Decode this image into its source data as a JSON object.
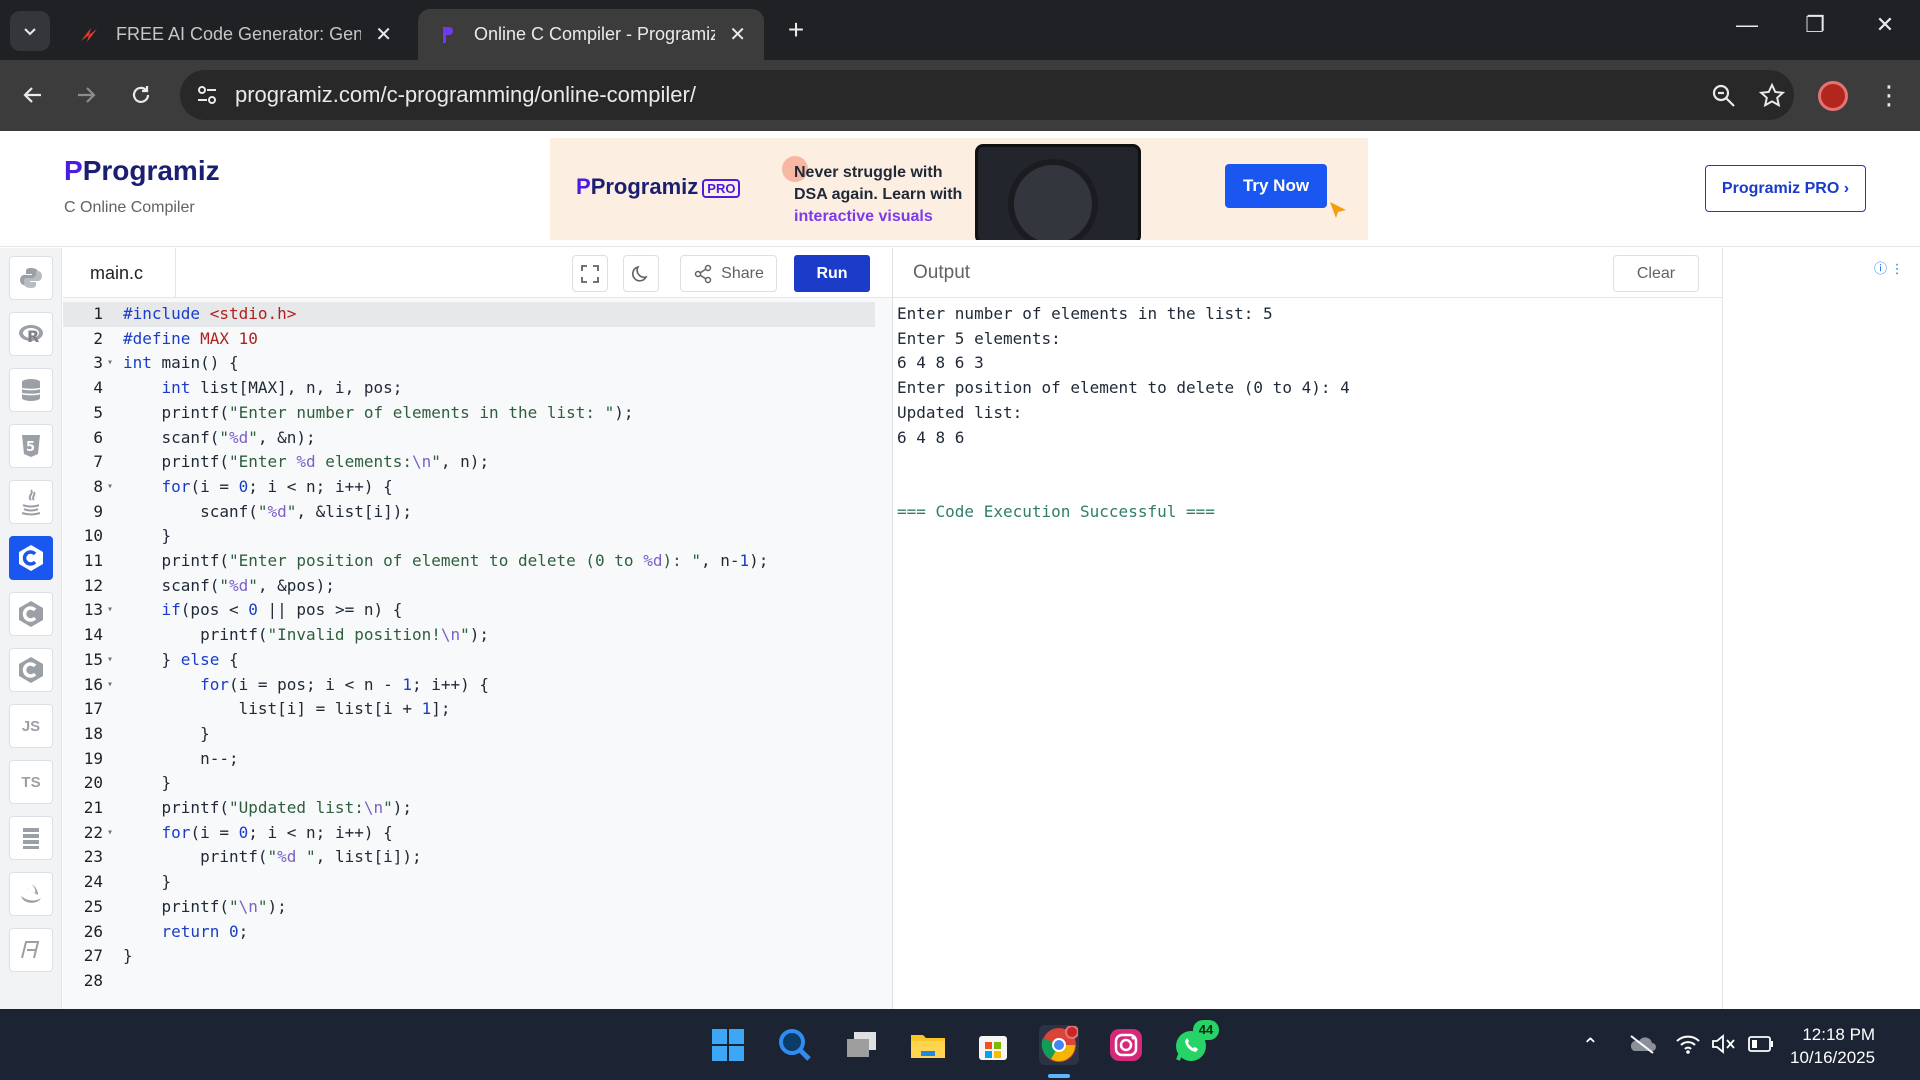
{
  "browser": {
    "tabs": [
      {
        "title": "FREE AI Code Generator: Gener",
        "active": false
      },
      {
        "title": "Online C Compiler - Programiz",
        "active": true
      }
    ],
    "url": "programiz.com/c-programming/online-compiler/"
  },
  "header": {
    "logo": "Programiz",
    "subtitle": "C Online Compiler",
    "ad": {
      "logo": "Programiz",
      "logo_badge": "PRO",
      "text_line1": "Never struggle with",
      "text_line2": "DSA again. Learn with",
      "text_line3": "interactive visuals",
      "cta": "Try Now"
    },
    "pro_button": "Programiz PRO ›"
  },
  "sidebar": {
    "languages": [
      {
        "name": "python",
        "label": ""
      },
      {
        "name": "r",
        "label": ""
      },
      {
        "name": "sql",
        "label": ""
      },
      {
        "name": "html",
        "label": ""
      },
      {
        "name": "java",
        "label": ""
      },
      {
        "name": "c",
        "label": "",
        "active": true
      },
      {
        "name": "cpp",
        "label": ""
      },
      {
        "name": "csharp",
        "label": ""
      },
      {
        "name": "js",
        "label": "JS"
      },
      {
        "name": "ts",
        "label": "TS"
      },
      {
        "name": "go",
        "label": ""
      },
      {
        "name": "swift",
        "label": ""
      },
      {
        "name": "php",
        "label": ""
      }
    ]
  },
  "editor": {
    "file_name": "main.c",
    "share_label": "Share",
    "run_label": "Run",
    "lines": [
      "#include <stdio.h>",
      "#define MAX 10",
      "int main() {",
      "    int list[MAX], n, i, pos;",
      "    printf(\"Enter number of elements in the list: \");",
      "    scanf(\"%d\", &n);",
      "    printf(\"Enter %d elements:\\n\", n);",
      "    for(i = 0; i < n; i++) {",
      "        scanf(\"%d\", &list[i]);",
      "    }",
      "    printf(\"Enter position of element to delete (0 to %d): \", n-1);",
      "    scanf(\"%d\", &pos);",
      "    if(pos < 0 || pos >= n) {",
      "        printf(\"Invalid position!\\n\");",
      "    } else {",
      "        for(i = pos; i < n - 1; i++) {",
      "            list[i] = list[i + 1];",
      "        }",
      "        n--;",
      "    }",
      "    printf(\"Updated list:\\n\");",
      "    for(i = 0; i < n; i++) {",
      "        printf(\"%d \", list[i]);",
      "    }",
      "    printf(\"\\n\");",
      "    return 0;",
      "}",
      ""
    ],
    "foldable_lines": [
      3,
      8,
      13,
      15,
      16,
      22
    ]
  },
  "output": {
    "title": "Output",
    "clear_label": "Clear",
    "lines": [
      "Enter number of elements in the list: 5",
      "Enter 5 elements:",
      "6 4 8 6 3",
      "Enter position of element to delete (0 to 4): 4",
      "Updated list:",
      "6 4 8 6",
      "",
      "",
      "=== Code Execution Successful ==="
    ]
  },
  "taskbar": {
    "whatsapp_badge": "44",
    "time": "12:18 PM",
    "date": "10/16/2025"
  },
  "colors": {
    "accent": "#1a3cc8",
    "active_lang": "#1a56f0",
    "chrome_bg": "#202124"
  }
}
